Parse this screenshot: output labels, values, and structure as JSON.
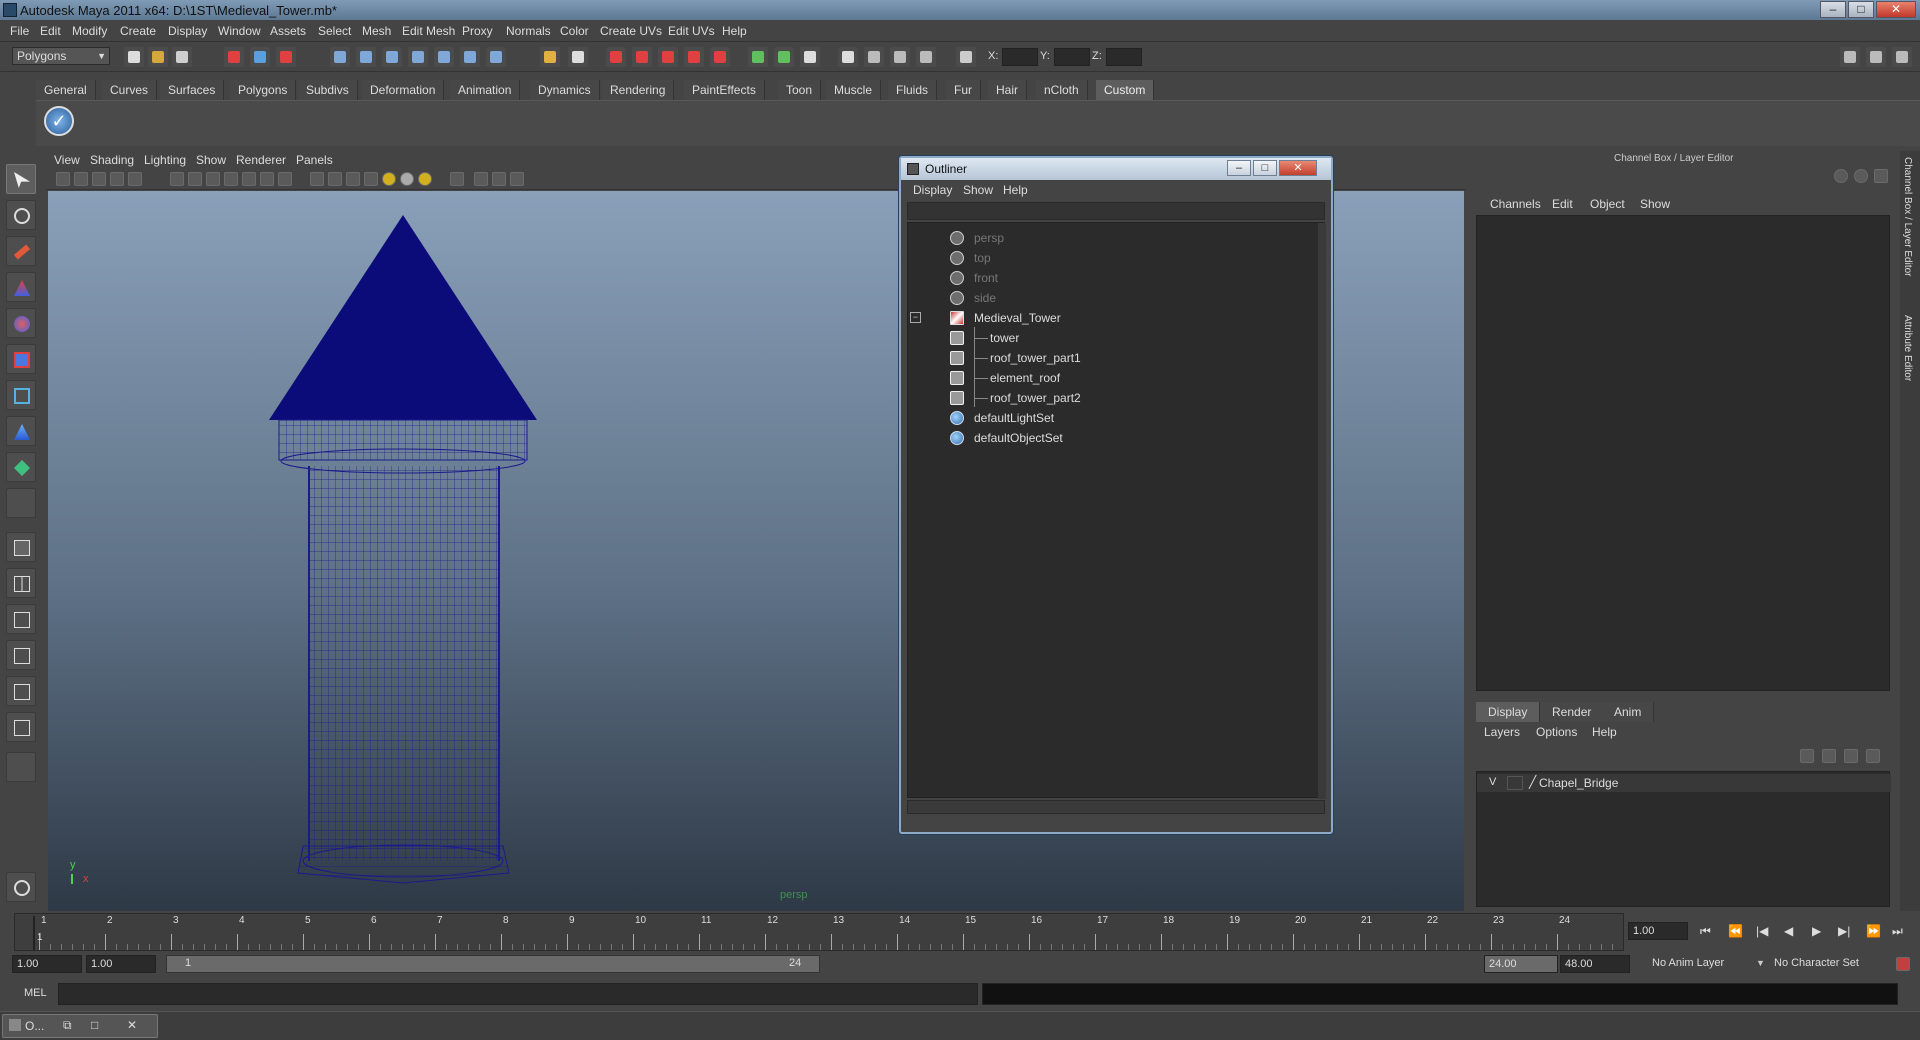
{
  "titlebar": {
    "title": "Autodesk Maya 2011 x64: D:\\1ST\\Medieval_Tower.mb*",
    "min": "–",
    "max": "□",
    "close": "✕"
  },
  "menubar": [
    "File",
    "Edit",
    "Modify",
    "Create",
    "Display",
    "Window",
    "Assets",
    "Select",
    "Mesh",
    "Edit Mesh",
    "Proxy",
    "Normals",
    "Color",
    "Create UVs",
    "Edit UVs",
    "Help"
  ],
  "statusline": {
    "menu_set": "Polygons",
    "x_label": "X:",
    "y_label": "Y:",
    "z_label": "Z:"
  },
  "shelf": {
    "tabs": [
      "General",
      "Curves",
      "Surfaces",
      "Polygons",
      "Subdivs",
      "Deformation",
      "Animation",
      "Dynamics",
      "Rendering",
      "PaintEffects",
      "Toon",
      "Muscle",
      "Fluids",
      "Fur",
      "Hair",
      "nCloth",
      "Custom"
    ],
    "active_tab": "Custom",
    "button_icon": "checkmark-icon"
  },
  "viewport": {
    "menu": [
      "View",
      "Shading",
      "Lighting",
      "Show",
      "Renderer",
      "Panels"
    ],
    "camera_label": "persp",
    "axis_y": "y",
    "axis_x": "x",
    "mesh_color": "#1a1a8c"
  },
  "outliner": {
    "title": "Outliner",
    "menu": [
      "Display",
      "Show",
      "Help"
    ],
    "items": [
      {
        "label": "persp",
        "dim": true,
        "icon": "camera-icon"
      },
      {
        "label": "top",
        "dim": true,
        "icon": "camera-icon"
      },
      {
        "label": "front",
        "dim": true,
        "icon": "camera-icon"
      },
      {
        "label": "side",
        "dim": true,
        "icon": "camera-icon"
      },
      {
        "label": "Medieval_Tower",
        "dim": false,
        "icon": "group-icon"
      },
      {
        "label": "tower",
        "dim": false,
        "icon": "mesh-icon"
      },
      {
        "label": "roof_tower_part1",
        "dim": false,
        "icon": "mesh-icon"
      },
      {
        "label": "element_roof",
        "dim": false,
        "icon": "mesh-icon"
      },
      {
        "label": "roof_tower_part2",
        "dim": false,
        "icon": "mesh-icon"
      },
      {
        "label": "defaultLightSet",
        "dim": false,
        "icon": "set-icon"
      },
      {
        "label": "defaultObjectSet",
        "dim": false,
        "icon": "set-icon"
      }
    ]
  },
  "channelbox": {
    "header": "Channel Box / Layer Editor",
    "menu": [
      "Channels",
      "Edit",
      "Object",
      "Show"
    ],
    "layer_tabs": [
      "Display",
      "Render",
      "Anim"
    ],
    "active_layer_tab": "Display",
    "layer_menu": [
      "Layers",
      "Options",
      "Help"
    ],
    "layers": [
      {
        "visible": "V",
        "name": "Chapel_Bridge"
      }
    ]
  },
  "side_tabs": [
    "Channel Box / Layer Editor",
    "Attribute Editor"
  ],
  "timeline": {
    "frames": [
      "1",
      "2",
      "3",
      "4",
      "5",
      "6",
      "7",
      "8",
      "9",
      "10",
      "11",
      "12",
      "13",
      "14",
      "15",
      "16",
      "17",
      "18",
      "19",
      "20",
      "21",
      "22",
      "23",
      "24"
    ],
    "current_frame_label": "1",
    "current_time": "1.00"
  },
  "range": {
    "start": "1.00",
    "playback_start": "1.00",
    "slider_start": "1",
    "slider_end": "24",
    "playback_end": "24.00",
    "end": "48.00",
    "anim_layer": "No Anim Layer",
    "character_set": "No Character Set"
  },
  "command": {
    "label": "MEL"
  },
  "taskbar": {
    "label": "O..."
  }
}
